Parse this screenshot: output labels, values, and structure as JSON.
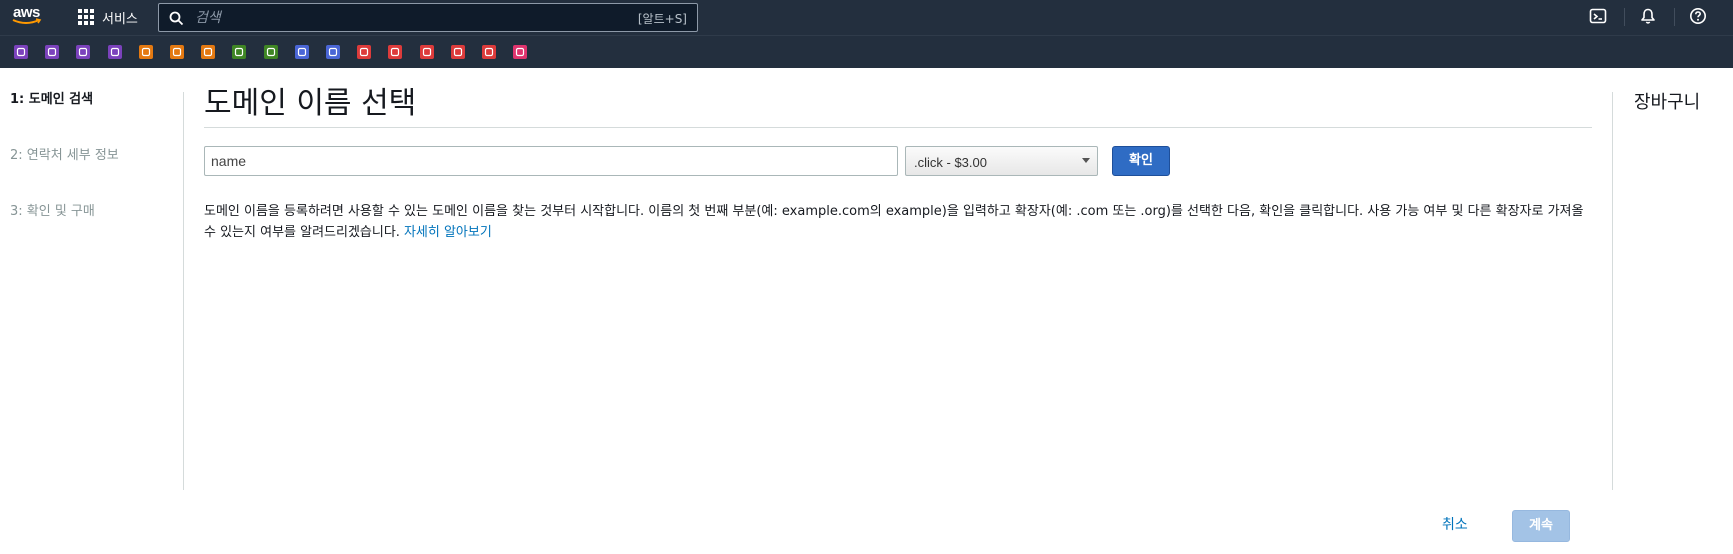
{
  "topnav": {
    "logo_text": "aws",
    "services_label": "서비스",
    "search_placeholder": "검색",
    "search_shortcut": "[알트+S]",
    "icons": [
      "cloudshell-icon",
      "notifications-bell-icon",
      "help-icon"
    ]
  },
  "favorites": [
    {
      "name": "favorite-service-1",
      "color": "#7b42bc"
    },
    {
      "name": "favorite-service-2",
      "color": "#7b42bc"
    },
    {
      "name": "favorite-service-3",
      "color": "#7b42bc"
    },
    {
      "name": "favorite-service-4",
      "color": "#7b42bc"
    },
    {
      "name": "favorite-service-5",
      "color": "#e47911"
    },
    {
      "name": "favorite-service-6",
      "color": "#e47911"
    },
    {
      "name": "favorite-service-7",
      "color": "#e47911"
    },
    {
      "name": "favorite-service-8",
      "color": "#3f8624"
    },
    {
      "name": "favorite-service-9",
      "color": "#3f8624"
    },
    {
      "name": "favorite-service-10",
      "color": "#4a66d6"
    },
    {
      "name": "favorite-service-11",
      "color": "#4a66d6"
    },
    {
      "name": "favorite-service-12",
      "color": "#dd3b3b"
    },
    {
      "name": "favorite-service-13",
      "color": "#dd3b3b"
    },
    {
      "name": "favorite-service-14",
      "color": "#dd3b3b"
    },
    {
      "name": "favorite-service-15",
      "color": "#dd3b3b"
    },
    {
      "name": "favorite-service-16",
      "color": "#dd3b3b"
    },
    {
      "name": "favorite-service-17",
      "color": "#e0346e"
    }
  ],
  "steps": [
    {
      "label": "1: 도메인 검색",
      "active": true
    },
    {
      "label": "2: 연락처 세부 정보",
      "active": false
    },
    {
      "label": "3: 확인 및 구매",
      "active": false
    }
  ],
  "main": {
    "title": "도메인 이름 선택",
    "name_input_value": "name",
    "tld_selected": ".click - $3.00",
    "check_label": "확인",
    "description": "도메인 이름을 등록하려면 사용할 수 있는 도메인 이름을 찾는 것부터 시작합니다. 이름의 첫 번째 부분(예: example.com의 example)을 입력하고 확장자(예: .com 또는 .org)를 선택한 다음, 확인을 클릭합니다. 사용 가능 여부 및 다른 확장자로 가져올 수 있는지 여부를 알려드리겠습니다.",
    "learn_more": "자세히 알아보기"
  },
  "cart": {
    "title": "장바구니"
  },
  "footer": {
    "cancel_label": "취소",
    "continue_label": "계속"
  }
}
